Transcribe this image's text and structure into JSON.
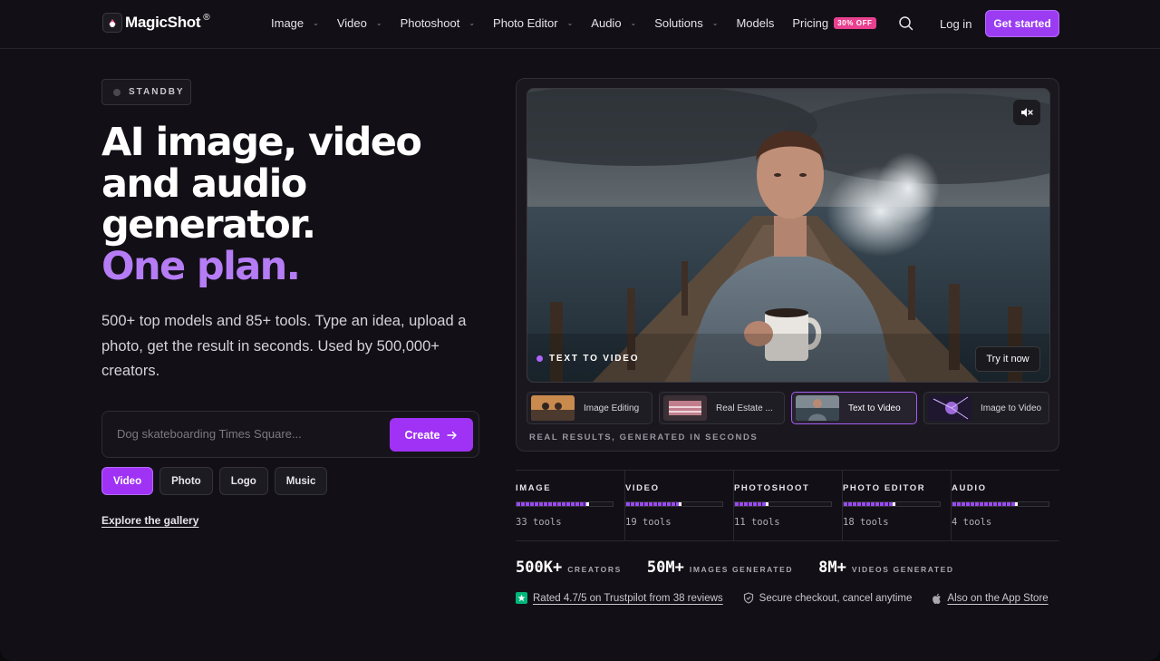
{
  "nav": {
    "logo": "MagicShot",
    "logo_reg": "®",
    "menu": [
      {
        "label": "Image",
        "has_dropdown": true
      },
      {
        "label": "Video",
        "has_dropdown": true
      },
      {
        "label": "Photoshoot",
        "has_dropdown": true
      },
      {
        "label": "Photo Editor",
        "has_dropdown": true
      },
      {
        "label": "Audio",
        "has_dropdown": true
      },
      {
        "label": "Solutions",
        "has_dropdown": true
      },
      {
        "label": "Models",
        "has_dropdown": false
      },
      {
        "label": "Pricing",
        "has_dropdown": false,
        "badge": "30% OFF"
      }
    ],
    "login": "Log in",
    "cta": "Get started",
    "accent_color": "#9b3cf2"
  },
  "hero": {
    "status": "STANDBY",
    "headline_lines": [
      "AI image, video",
      "and audio",
      "generator."
    ],
    "headline_accent": "One plan.",
    "subtext": "500+ top models and 85+ tools. Type an idea, upload a photo, get the result in seconds. Used by 500,000+ creators.",
    "prompt_placeholder": "Dog skateboarding Times Square...",
    "prompt_value": "",
    "create_label": "Create",
    "chips": [
      {
        "label": "Video",
        "active": true
      },
      {
        "label": "Photo",
        "active": false
      },
      {
        "label": "Logo",
        "active": false
      },
      {
        "label": "Music",
        "active": false
      }
    ],
    "explore": "Explore the gallery"
  },
  "preview": {
    "video_label": "TEXT TO VIDEO",
    "try_label": "Try it now",
    "thumbs": [
      {
        "label": "Image Editing",
        "active": false
      },
      {
        "label": "Real Estate ...",
        "active": false
      },
      {
        "label": "Text to Video",
        "active": true
      },
      {
        "label": "Image to Video",
        "active": false
      }
    ],
    "caption": "REAL RESULTS, GENERATED IN SECONDS"
  },
  "categories": [
    {
      "name": "IMAGE",
      "count": "33 tools",
      "fill": 0.75
    },
    {
      "name": "VIDEO",
      "count": "19 tools",
      "fill": 0.58
    },
    {
      "name": "PHOTOSHOOT",
      "count": "11 tools",
      "fill": 0.35
    },
    {
      "name": "PHOTO EDITOR",
      "count": "18 tools",
      "fill": 0.54
    },
    {
      "name": "AUDIO",
      "count": "4 tools",
      "fill": 0.68
    }
  ],
  "stats": [
    {
      "value": "500K+",
      "label": "CREATORS"
    },
    {
      "value": "50M+",
      "label": "IMAGES GENERATED"
    },
    {
      "value": "8M+",
      "label": "VIDEOS GENERATED"
    }
  ],
  "trust": {
    "trustpilot": "Rated 4.7/5 on Trustpilot from 38 reviews",
    "secure": "Secure checkout, cancel anytime",
    "appstore": "Also on the App Store"
  }
}
